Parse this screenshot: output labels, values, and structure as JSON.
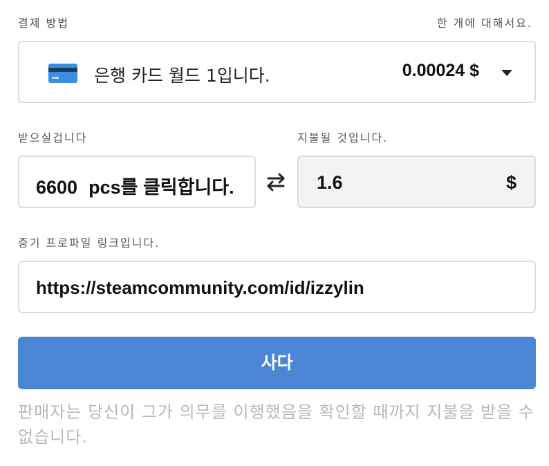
{
  "payment": {
    "section_label": "결제 방법",
    "per_unit_label": "한 개에 대해서요.",
    "card_icon": "credit-card-icon",
    "method_name": "은행 카드 월드 1입니다.",
    "price": "0.00024 $"
  },
  "receive": {
    "label": "받으실겁니다",
    "quantity": "6600",
    "unit_text": "pcs를 클릭합니다."
  },
  "pay": {
    "label": "지불될 것입니다.",
    "amount": "1.6",
    "currency": "$"
  },
  "profile": {
    "label": "증기 프로파일 링크입니다.",
    "url": "https://steamcommunity.com/id/izzylin"
  },
  "buy_button": {
    "label": "사다"
  },
  "notice": "판매자는 당신이 그가 의무를 이행했음을 확인할 때까지 지불을 받을 수 없습니다.",
  "colors": {
    "accent": "#4a86d4",
    "card_blue": "#3a8ee0",
    "muted_text": "#b8b8b8"
  }
}
